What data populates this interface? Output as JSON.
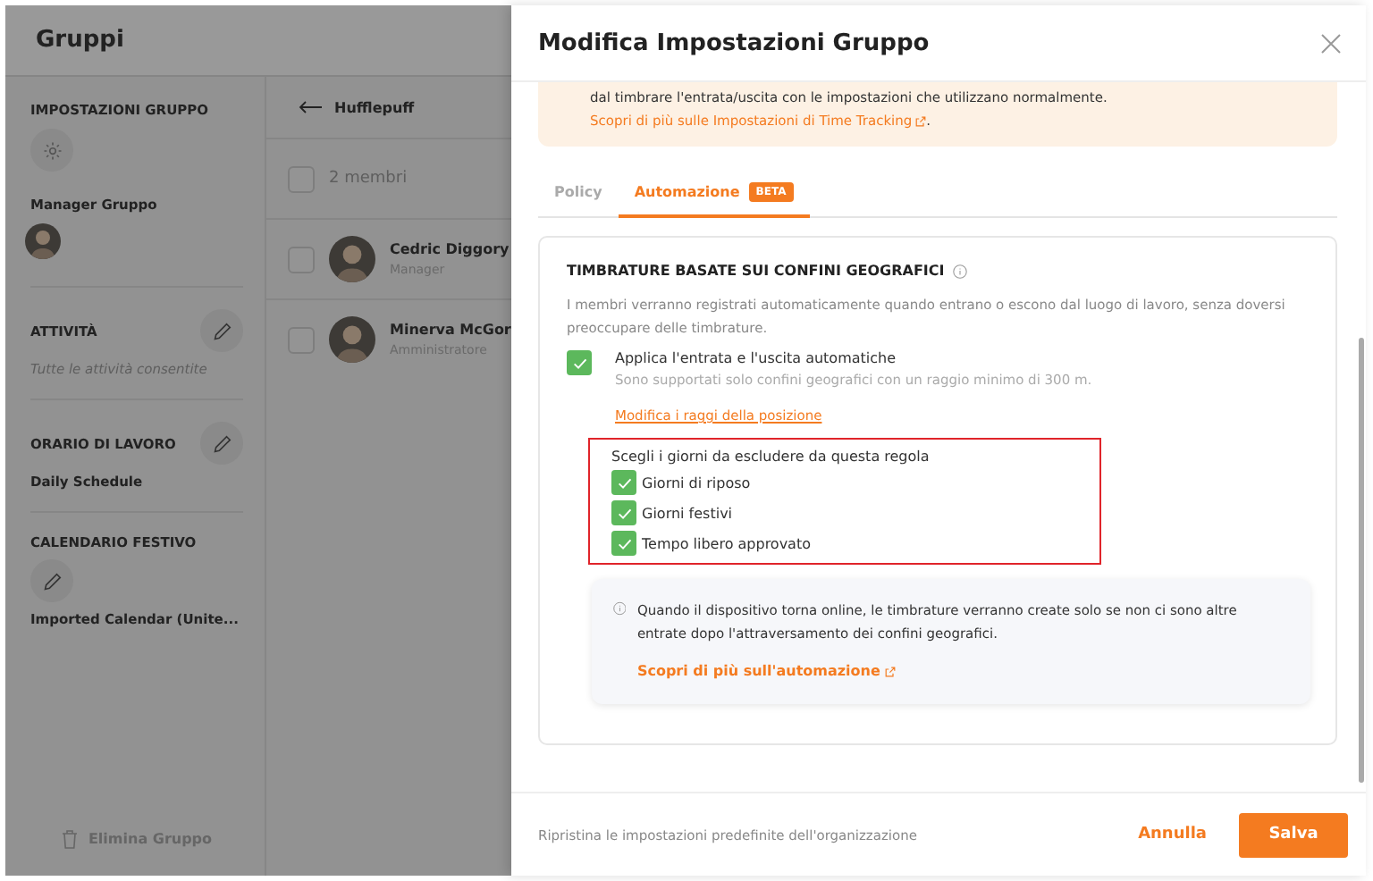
{
  "header": {
    "title": "Gruppi"
  },
  "sidebar": {
    "group_settings": {
      "label": "IMPOSTAZIONI GRUPPO"
    },
    "manager": {
      "label": "Manager Gruppo"
    },
    "sections": [
      {
        "kind": "activity",
        "label": "ATTIVITÀ",
        "value": "Tutte le attività consentite"
      },
      {
        "kind": "schedule",
        "label": "ORARIO DI LAVORO",
        "value": "Daily Schedule"
      },
      {
        "kind": "calendar",
        "label": "CALENDARIO FESTIVO",
        "value": "Imported Calendar (Unite..."
      }
    ],
    "delete_button": "Elimina Gruppo"
  },
  "members": {
    "group": "Hufflepuff",
    "count": "2 membri",
    "select_all_checked": false,
    "rows": [
      {
        "name": "Cedric Diggory",
        "role": "Manager",
        "checked": false
      },
      {
        "name": "Minerva McGor",
        "role": "Amministratore",
        "checked": false
      }
    ]
  },
  "panel": {
    "title": "Modifica Impostazioni Gruppo",
    "notice": {
      "text": "dal timbrare l'entrata/uscita con le impostazioni che utilizzano normalmente.",
      "link": "Scopri di più sulle Impostazioni di Time Tracking",
      "tail": "."
    },
    "tabs": [
      {
        "label": "Policy",
        "selected": false
      },
      {
        "label": "Automazione",
        "badge": "BETA",
        "selected": true
      }
    ],
    "card": {
      "title": "TIMBRATURE BASATE SUI CONFINI GEOGRAFICI",
      "description": "I membri verranno registrati automaticamente quando entrano o escono dal luogo di lavoro, senza doversi preoccupare delle timbrature.",
      "auto": {
        "label": "Applica l'entrata e l'uscita automatiche",
        "checked": true,
        "hint": "Sono supportati solo confini geografici con un raggio minimo di 300 m.",
        "link": "Modifica i raggi della posizione"
      },
      "exclusions": {
        "title": "Scegli i giorni da escludere da questa regola",
        "options": [
          {
            "label": "Giorni di riposo",
            "checked": true
          },
          {
            "label": "Giorni festivi",
            "checked": true
          },
          {
            "label": "Tempo libero approvato",
            "checked": true
          }
        ]
      },
      "info": {
        "text": "Quando il dispositivo torna online, le timbrature verranno create solo se non ci sono altre entrate dopo l'attraversamento dei confini geografici.",
        "link": "Scopri di più sull'automazione"
      }
    },
    "footer": {
      "reset": "Ripristina le impostazioni predefinite dell'organizzazione",
      "cancel": "Annulla",
      "save": "Salva"
    }
  }
}
